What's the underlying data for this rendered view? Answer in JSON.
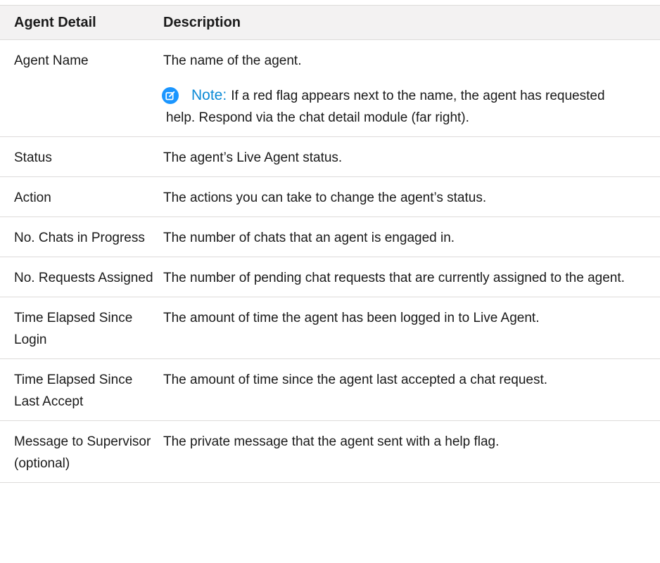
{
  "table": {
    "headers": [
      "Agent Detail",
      "Description"
    ],
    "rows": [
      {
        "detail": "Agent Name",
        "description": "The name of the agent.",
        "note": {
          "title": "Note:",
          "line1": "If a red flag appears next to the name, the agent has requested",
          "line2": "help. Respond via the chat detail module (far right)."
        }
      },
      {
        "detail": "Status",
        "description": "The agent’s Live Agent status."
      },
      {
        "detail": "Action",
        "description": "The actions you can take to change the agent’s status."
      },
      {
        "detail": "No. Chats in Progress",
        "description": "The number of chats that an agent is engaged in."
      },
      {
        "detail": "No. Requests Assigned",
        "description": "The number of pending chat requests that are currently assigned to the agent."
      },
      {
        "detail": "Time Elapsed Since Login",
        "description": "The amount of time the agent has been logged in to Live Agent."
      },
      {
        "detail": "Time Elapsed Since Last Accept",
        "description": "The amount of time since the agent last accepted a chat request."
      },
      {
        "detail": "Message to Supervisor (optional)",
        "description": "The private message that the agent sent with a help flag."
      }
    ]
  },
  "colors": {
    "header_bg": "#f3f2f2",
    "border": "#dddbda",
    "note_accent": "#0b8ad6",
    "note_icon_bg": "#1b96ff"
  },
  "icons": {
    "note": "edit-note-icon"
  }
}
